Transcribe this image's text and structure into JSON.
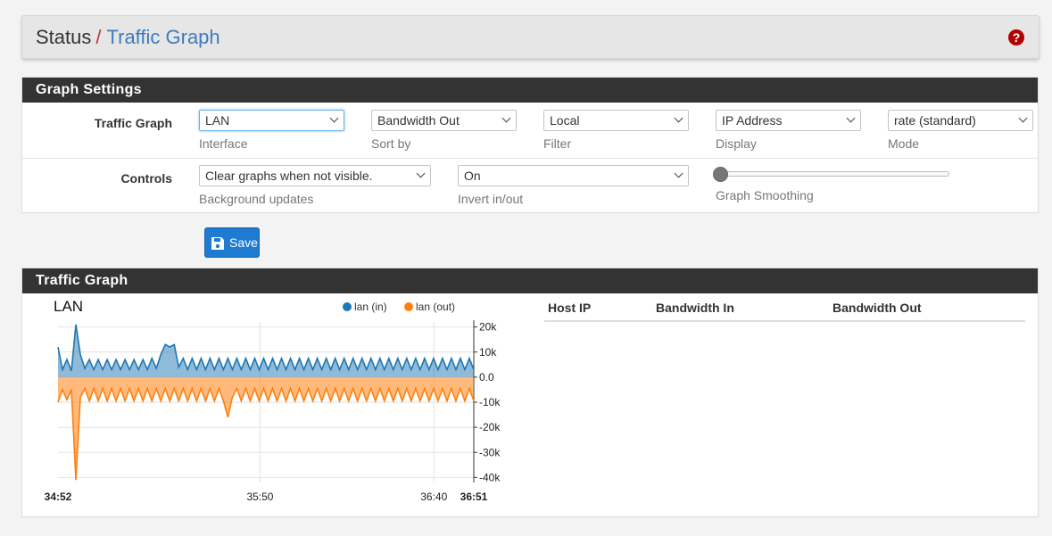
{
  "breadcrumb": {
    "root": "Status",
    "separator": "/",
    "current": "Traffic Graph"
  },
  "help_icon": "question-circle-icon",
  "settings": {
    "heading": "Graph Settings",
    "row1": {
      "label": "Traffic Graph",
      "interface": {
        "value": "LAN",
        "help": "Interface"
      },
      "sort_by": {
        "value": "Bandwidth Out",
        "help": "Sort by"
      },
      "filter": {
        "value": "Local",
        "help": "Filter"
      },
      "display": {
        "value": "IP Address",
        "help": "Display"
      },
      "mode": {
        "value": "rate (standard)",
        "help": "Mode"
      }
    },
    "row2": {
      "label": "Controls",
      "background": {
        "value": "Clear graphs when not visible.",
        "help": "Background updates"
      },
      "invert": {
        "value": "On",
        "help": "Invert in/out"
      },
      "smoothing": {
        "help": "Graph Smoothing",
        "value": 0
      }
    },
    "save_label": "Save",
    "save_icon": "floppy-disk-icon"
  },
  "graph": {
    "heading": "Traffic Graph",
    "table_headers": [
      "Host IP",
      "Bandwidth In",
      "Bandwidth Out"
    ]
  },
  "chart_data": {
    "type": "area",
    "title": "LAN",
    "legend_position": "top-right",
    "series": [
      {
        "name": "lan (in)",
        "color": "#1f77b4",
        "values": [
          12000,
          3000,
          7000,
          2500,
          21000,
          9000,
          3500,
          7000,
          3000,
          7000,
          3000,
          7000,
          3000,
          7000,
          3000,
          7000,
          3000,
          7000,
          3000,
          7000,
          3000,
          7500,
          3500,
          9000,
          13000,
          12000,
          13000,
          4000,
          7500,
          3000,
          7500,
          3000,
          7500,
          3000,
          7500,
          3000,
          7500,
          3000,
          7500,
          3000,
          7500,
          3000,
          7500,
          3000,
          7500,
          3000,
          7500,
          3000,
          7500,
          3000,
          7500,
          3000,
          7500,
          3000,
          7500,
          3000,
          7500,
          3000,
          7500,
          3000,
          7500,
          3000,
          7500,
          3000,
          7500,
          3000,
          7500,
          3000,
          7500,
          3000,
          7500,
          3000,
          7500,
          3000,
          7500,
          3000,
          7500,
          3000,
          7500,
          3000,
          7500,
          3000,
          7500,
          3000,
          7500,
          3000,
          7500,
          3000,
          7500,
          3000,
          7500,
          3000,
          7500,
          3000
        ]
      },
      {
        "name": "lan (out)",
        "color": "#ff7f0e",
        "values": [
          -10000,
          -5000,
          -9000,
          -5000,
          -41000,
          -8000,
          -4500,
          -9500,
          -4500,
          -9500,
          -4500,
          -9500,
          -4500,
          -9500,
          -4500,
          -9500,
          -4500,
          -9500,
          -4500,
          -9500,
          -4500,
          -9500,
          -4500,
          -9500,
          -4500,
          -9500,
          -4500,
          -9500,
          -4500,
          -9500,
          -4500,
          -9500,
          -4500,
          -9500,
          -4500,
          -9500,
          -4500,
          -9500,
          -16000,
          -8000,
          -4500,
          -9500,
          -4500,
          -9500,
          -4500,
          -9500,
          -4500,
          -9500,
          -4500,
          -9500,
          -4500,
          -9500,
          -4500,
          -9500,
          -4500,
          -9500,
          -4500,
          -9500,
          -4500,
          -9500,
          -4500,
          -9500,
          -4500,
          -9500,
          -4500,
          -9500,
          -4500,
          -9500,
          -4500,
          -9500,
          -4500,
          -9500,
          -4500,
          -9500,
          -4500,
          -9500,
          -4500,
          -9500,
          -4500,
          -9500,
          -4500,
          -9500,
          -4500,
          -9500,
          -4500,
          -9500,
          -4500,
          -9500,
          -4500,
          -9500,
          -4500,
          -9500,
          -4500,
          -9500
        ]
      }
    ],
    "ylim": [
      -42000,
      22000
    ],
    "y_ticks": [
      20000,
      10000,
      0,
      -10000,
      -20000,
      -30000,
      -40000
    ],
    "y_tick_labels": [
      "20k",
      "10k",
      "0.0",
      "-10k",
      "-20k",
      "-30k",
      "-40k"
    ],
    "x_tick_labels": [
      {
        "label": "34:52",
        "pos": 0,
        "bold": true
      },
      {
        "label": "35:50",
        "pos": 0.486,
        "bold": false
      },
      {
        "label": "36:40",
        "pos": 0.904,
        "bold": false
      },
      {
        "label": "36:51",
        "pos": 1,
        "bold": true
      }
    ],
    "grid": true
  }
}
